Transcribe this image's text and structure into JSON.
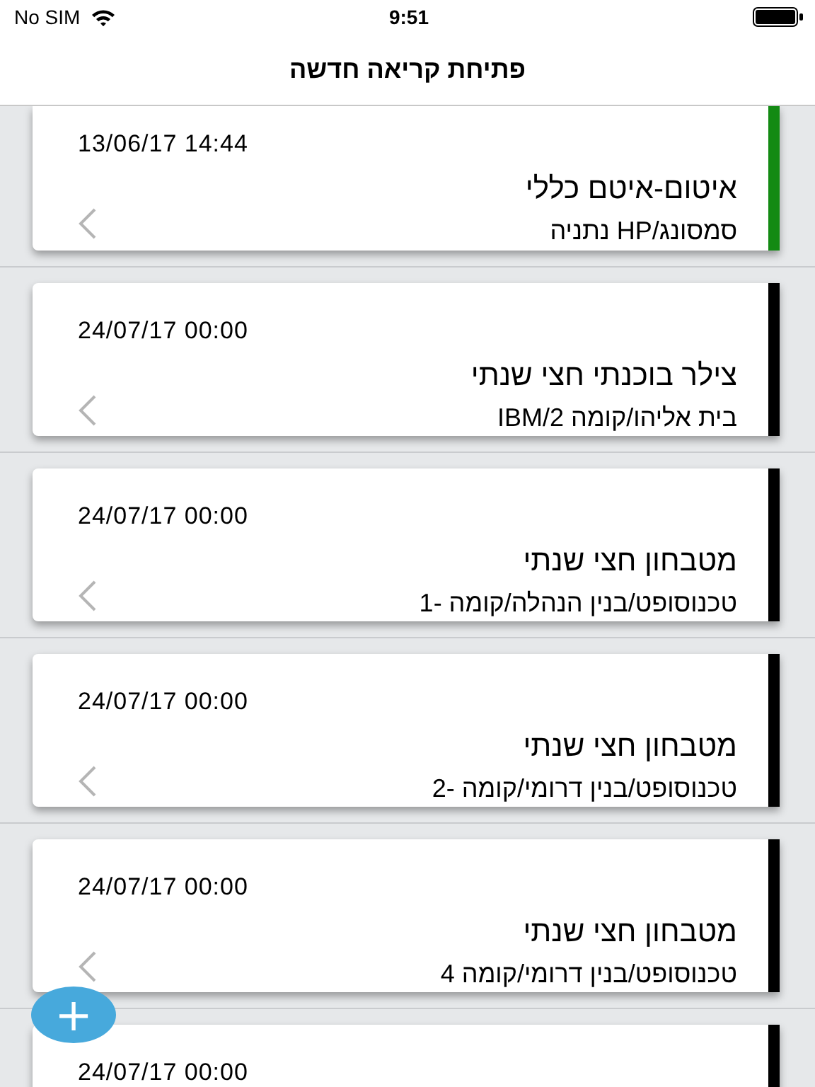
{
  "status_bar": {
    "carrier": "No SIM",
    "time": "9:51"
  },
  "nav": {
    "title": "פתיחת קריאה חדשה"
  },
  "cards": [
    {
      "date": "13/06/17 14:44",
      "title": "איטום-איטם כללי",
      "location": "סמסונג/HP נתניה",
      "color": "#138a13"
    },
    {
      "date": "24/07/17 00:00",
      "title": "צילר בוכנתי חצי שנתי",
      "location": "בית אליהו/קומה IBM/2",
      "color": "#000000"
    },
    {
      "date": "24/07/17 00:00",
      "title": "מטבחון  חצי שנתי",
      "location": "טכנוסופט/בנין הנהלה/קומה -1",
      "color": "#000000"
    },
    {
      "date": "24/07/17 00:00",
      "title": "מטבחון  חצי שנתי",
      "location": "טכנוסופט/בנין דרומי/קומה -2",
      "color": "#000000"
    },
    {
      "date": "24/07/17 00:00",
      "title": "מטבחון  חצי שנתי",
      "location": "טכנוסופט/בנין דרומי/קומה 4",
      "color": "#000000"
    },
    {
      "date": "24/07/17 00:00",
      "color": "#000000"
    }
  ],
  "fab": {
    "label": "+"
  }
}
